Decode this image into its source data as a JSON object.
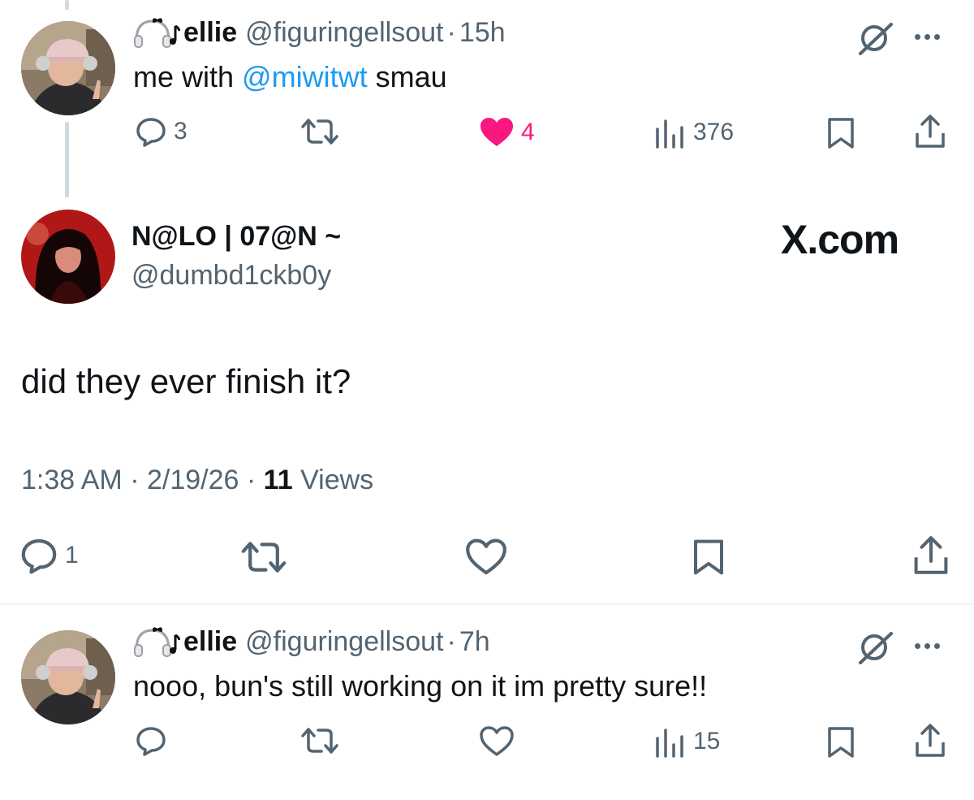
{
  "colors": {
    "text": "#0f1419",
    "secondary": "#536471",
    "link": "#1d9bf0",
    "like": "#f91880",
    "divider": "#eff3f4"
  },
  "tweet_top": {
    "display_name": "ellie",
    "handle": "@figuringellsout",
    "separator": "·",
    "time": "15h",
    "text_before": "me with ",
    "mention": "@miwitwt",
    "text_after": " smau",
    "reply_count": "3",
    "like_count": "4",
    "liked": true,
    "views_count": "376",
    "icons": [
      "headphones-emoji",
      "music-note",
      "grok-icon",
      "more-icon",
      "reply-icon",
      "retweet-icon",
      "like-icon",
      "views-icon",
      "bookmark-icon",
      "share-icon"
    ]
  },
  "main_tweet": {
    "display_name": "N@LO | 07@N ~",
    "handle": "@dumbd1ckb0y",
    "watermark": "X.com",
    "text": "did they ever finish it?",
    "time": "1:38 AM",
    "separator": "·",
    "date": "2/19/26",
    "views_num": "11",
    "views_label": "Views",
    "reply_count": "1"
  },
  "tweet_bottom": {
    "display_name": "ellie",
    "handle": "@figuringellsout",
    "separator": "·",
    "time": "7h",
    "text": "nooo, bun's still working on it im pretty sure!!",
    "views_count": "15"
  }
}
